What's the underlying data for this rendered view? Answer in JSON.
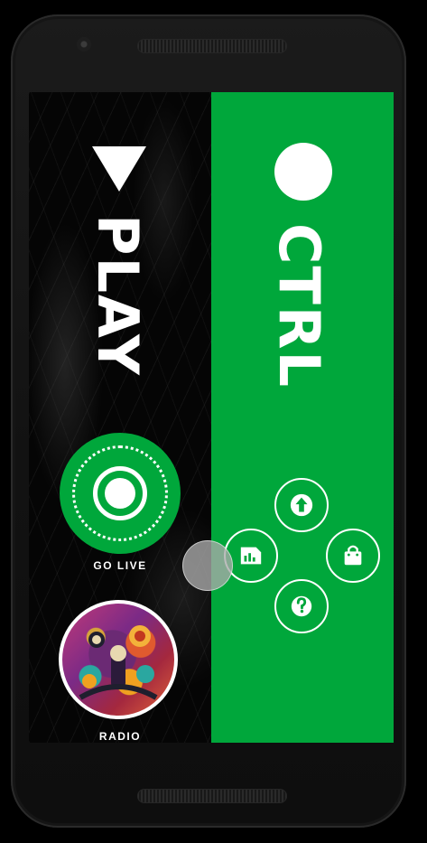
{
  "play_panel": {
    "title": "PLAY",
    "go_live_label": "GO LIVE",
    "radio_label": "RADIO"
  },
  "ctrl_panel": {
    "title": "CTRL",
    "buttons": {
      "up": "arrow-up-icon",
      "left": "stats-card-icon",
      "right": "shopping-bag-icon",
      "down": "help-icon"
    }
  },
  "colors": {
    "brand_green": "#00a73b",
    "play_background": "#050505",
    "text": "#ffffff"
  }
}
